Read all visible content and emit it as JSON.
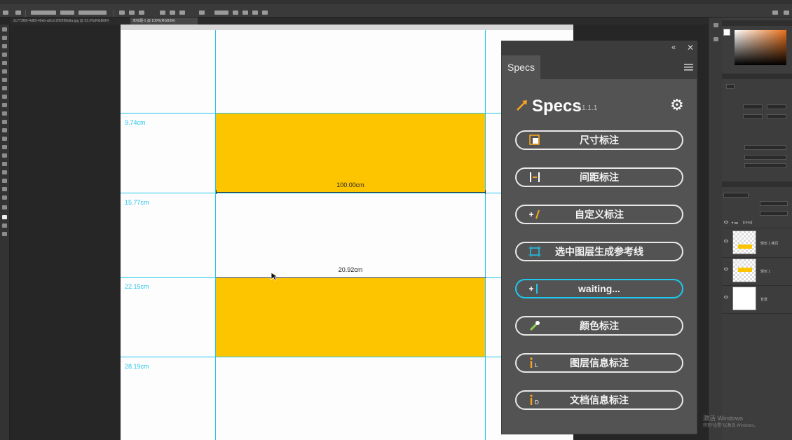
{
  "document": {
    "tabs": [
      "2c773f89-4d85-49eb-a0cd-2f5f3f9fa9a.jpg @ 33.3%(RGB/8#)",
      "未标题-1 @ 100%(RGB/8#)"
    ],
    "active_tab": 1
  },
  "canvas": {
    "row_labels": [
      "9.74cm",
      "15.77cm",
      "22.15cm",
      "28.19cm"
    ],
    "width_measure": "100.00cm",
    "gap_measure": "20.92cm",
    "accent": "#fdc500",
    "guide_color": "#21c5ec"
  },
  "specs": {
    "tab": "Specs",
    "title": "Specs",
    "version": "v.1.1.1",
    "buttons": [
      {
        "label": "尺寸标注",
        "icon": "size-annotation-icon"
      },
      {
        "label": "间距标注",
        "icon": "spacing-annotation-icon"
      },
      {
        "label": "自定义标注",
        "icon": "custom-annotation-icon"
      },
      {
        "label": "选中图层生成参考线",
        "icon": "guides-from-layer-icon"
      },
      {
        "label": "waiting...",
        "icon": "waiting-icon"
      },
      {
        "label": "颜色标注",
        "icon": "color-annotation-icon"
      },
      {
        "label": "图层信息标注",
        "icon": "layer-info-icon"
      },
      {
        "label": "文档信息标注",
        "icon": "document-info-icon"
      }
    ]
  },
  "layers": {
    "group": "[ceva]",
    "items": [
      "矩形 1 拷贝",
      "矩形 1",
      "背景"
    ]
  },
  "watermark": {
    "line1": "激活 Windows",
    "line2": "转到\"设置\"以激活 Windows。"
  }
}
